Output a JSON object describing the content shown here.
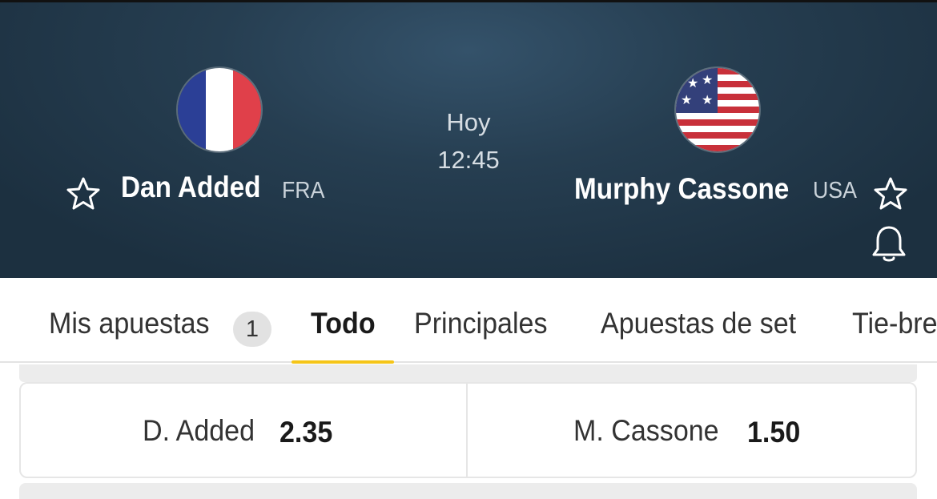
{
  "match": {
    "player1": {
      "name": "Dan Added",
      "country": "FRA"
    },
    "player2": {
      "name": "Murphy Cassone",
      "country": "USA"
    },
    "day": "Hoy",
    "time": "12:45"
  },
  "tabs": {
    "items": [
      "Mis apuestas",
      "Todo",
      "Principales",
      "Apuestas de set",
      "Tie-bre"
    ],
    "badge": "1",
    "active": "Todo"
  },
  "market": {
    "outcome1": {
      "label": "D. Added",
      "odds": "2.35"
    },
    "outcome2": {
      "label": "M. Cassone",
      "odds": "1.50"
    }
  },
  "colors": {
    "header_bg": "#263e51",
    "active_tab_underline": "#f5c518"
  },
  "icons": [
    "star-outline-icon",
    "bell-icon",
    "france-flag-icon",
    "usa-flag-icon"
  ]
}
